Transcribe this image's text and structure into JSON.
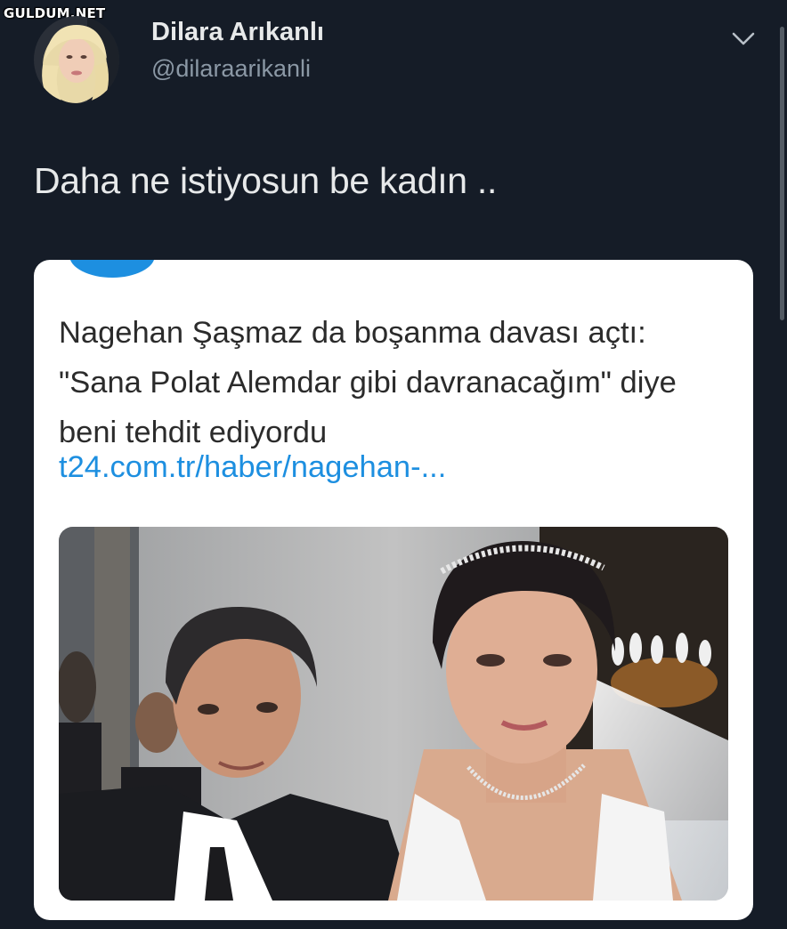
{
  "watermark": "GULDUM.NET",
  "tweet": {
    "display_name": "Dilara Arıkanlı",
    "handle": "@dilaraarikanli",
    "text": "Daha ne istiyosun be kadın .."
  },
  "card": {
    "headline": "Nagehan Şaşmaz da boşanma davası açtı: \"Sana Polat Alemdar gibi davranacağım\" diye beni tehdit ediyordu",
    "link": "t24.com.tr/haber/nagehan-..."
  },
  "colors": {
    "background": "#151c27",
    "link": "#1d8fe0",
    "secondary_text": "#8b98a5"
  },
  "icons": [
    "chevron-down-icon"
  ]
}
